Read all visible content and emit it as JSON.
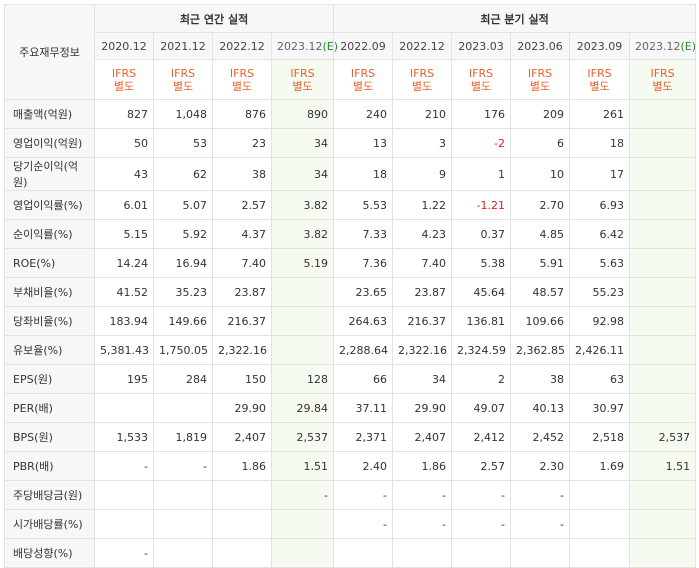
{
  "corner_label": "주요재무정보",
  "groups": {
    "annual": "최근 연간 실적",
    "quarterly": "최근 분기 실적"
  },
  "periods": [
    {
      "label": "2020.12",
      "est": ""
    },
    {
      "label": "2021.12",
      "est": ""
    },
    {
      "label": "2022.12",
      "est": ""
    },
    {
      "label": "2023.12",
      "est": "(E)"
    },
    {
      "label": "2022.09",
      "est": ""
    },
    {
      "label": "2022.12",
      "est": ""
    },
    {
      "label": "2023.03",
      "est": ""
    },
    {
      "label": "2023.06",
      "est": ""
    },
    {
      "label": "2023.09",
      "est": ""
    },
    {
      "label": "2023.12",
      "est": "(E)"
    }
  ],
  "ifrs_line1": "IFRS",
  "ifrs_line2": "별도",
  "rows": [
    {
      "label": "매출액(억원)",
      "values": [
        "827",
        "1,048",
        "876",
        "890",
        "240",
        "210",
        "176",
        "209",
        "261",
        ""
      ]
    },
    {
      "label": "영업이익(억원)",
      "values": [
        "50",
        "53",
        "23",
        "34",
        "13",
        "3",
        "-2",
        "6",
        "18",
        ""
      ]
    },
    {
      "label": "당기순이익(억원)",
      "values": [
        "43",
        "62",
        "38",
        "34",
        "18",
        "9",
        "1",
        "10",
        "17",
        ""
      ]
    },
    {
      "label": "영업이익률(%)",
      "values": [
        "6.01",
        "5.07",
        "2.57",
        "3.82",
        "5.53",
        "1.22",
        "-1.21",
        "2.70",
        "6.93",
        ""
      ]
    },
    {
      "label": "순이익률(%)",
      "values": [
        "5.15",
        "5.92",
        "4.37",
        "3.82",
        "7.33",
        "4.23",
        "0.37",
        "4.85",
        "6.42",
        ""
      ]
    },
    {
      "label": "ROE(%)",
      "values": [
        "14.24",
        "16.94",
        "7.40",
        "5.19",
        "7.36",
        "7.40",
        "5.38",
        "5.91",
        "5.63",
        ""
      ]
    },
    {
      "label": "부채비율(%)",
      "values": [
        "41.52",
        "35.23",
        "23.87",
        "",
        "23.65",
        "23.87",
        "45.64",
        "48.57",
        "55.23",
        ""
      ]
    },
    {
      "label": "당좌비율(%)",
      "values": [
        "183.94",
        "149.66",
        "216.37",
        "",
        "264.63",
        "216.37",
        "136.81",
        "109.66",
        "92.98",
        ""
      ]
    },
    {
      "label": "유보율(%)",
      "values": [
        "5,381.43",
        "1,750.05",
        "2,322.16",
        "",
        "2,288.64",
        "2,322.16",
        "2,324.59",
        "2,362.85",
        "2,426.11",
        ""
      ]
    },
    {
      "label": "EPS(원)",
      "values": [
        "195",
        "284",
        "150",
        "128",
        "66",
        "34",
        "2",
        "38",
        "63",
        ""
      ]
    },
    {
      "label": "PER(배)",
      "values": [
        "",
        "",
        "29.90",
        "29.84",
        "37.11",
        "29.90",
        "49.07",
        "40.13",
        "30.97",
        ""
      ]
    },
    {
      "label": "BPS(원)",
      "values": [
        "1,533",
        "1,819",
        "2,407",
        "2,537",
        "2,371",
        "2,407",
        "2,412",
        "2,452",
        "2,518",
        "2,537"
      ]
    },
    {
      "label": "PBR(배)",
      "values": [
        "-",
        "-",
        "1.86",
        "1.51",
        "2.40",
        "1.86",
        "2.57",
        "2.30",
        "1.69",
        "1.51"
      ]
    },
    {
      "label": "주당배당금(원)",
      "values": [
        "",
        "",
        "",
        "-",
        "-",
        "-",
        "-",
        "-",
        "",
        ""
      ]
    },
    {
      "label": "시가배당률(%)",
      "values": [
        "",
        "",
        "",
        "",
        "-",
        "-",
        "-",
        "-",
        "",
        ""
      ]
    },
    {
      "label": "배당성향(%)",
      "values": [
        "-",
        "",
        "",
        "",
        "",
        "",
        "",
        "",
        "",
        ""
      ]
    }
  ]
}
